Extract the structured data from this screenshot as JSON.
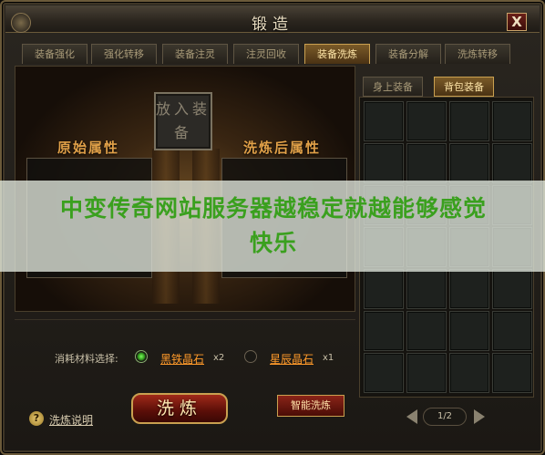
{
  "window": {
    "title": "锻造",
    "close_label": "X"
  },
  "tabs": [
    {
      "label": "装备强化",
      "active": false
    },
    {
      "label": "强化转移",
      "active": false
    },
    {
      "label": "装备注灵",
      "active": false
    },
    {
      "label": "注灵回收",
      "active": false
    },
    {
      "label": "装备洗炼",
      "active": true
    },
    {
      "label": "装备分解",
      "active": false
    },
    {
      "label": "洗炼转移",
      "active": false
    }
  ],
  "refine": {
    "slot_text": "放入装备",
    "original_attr_label": "原始属性",
    "refined_attr_label": "洗炼后属性"
  },
  "overlay": {
    "text": "中变传奇网站服务器越稳定就越能够感觉快乐"
  },
  "inventory": {
    "tabs": [
      {
        "label": "身上装备",
        "active": false
      },
      {
        "label": "背包装备",
        "active": true
      }
    ],
    "grid": {
      "columns": 4,
      "rows": 7
    },
    "page": "1/2"
  },
  "materials": {
    "label": "消耗材料选择:",
    "options": [
      {
        "name": "黑铁晶石",
        "count": "x2",
        "selected": true
      },
      {
        "name": "星辰晶石",
        "count": "x1",
        "selected": false
      }
    ]
  },
  "actions": {
    "help_label": "洗炼说明",
    "help_icon": "?",
    "refine_label": "洗炼",
    "smart_refine_label": "智能洗炼"
  }
}
